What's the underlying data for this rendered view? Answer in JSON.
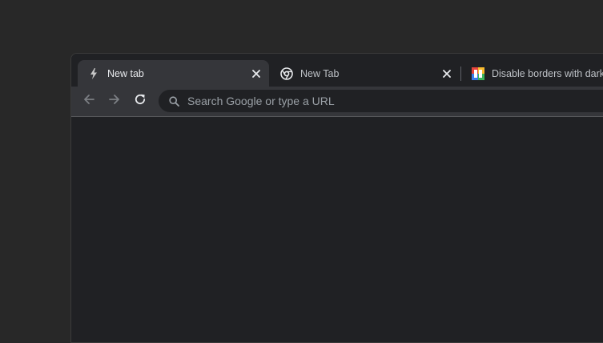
{
  "tabs": [
    {
      "title": "New tab",
      "favicon": "bolt-icon",
      "active": true
    },
    {
      "title": "New Tab",
      "favicon": "chrome-icon",
      "active": false
    },
    {
      "title": "Disable borders with dark a",
      "favicon": "colorful-app-icon",
      "active": false
    }
  ],
  "toolbar": {
    "back": "arrow-left-icon",
    "forward": "arrow-right-icon",
    "reload": "reload-icon"
  },
  "omnibox": {
    "placeholder": "Search Google or type a URL",
    "value": "",
    "icon": "search-icon"
  },
  "colors": {
    "desktop": "#282828",
    "frame": "#202124",
    "active_tab": "#35363a",
    "text": "#e8eaed",
    "placeholder": "#9aa0a6"
  }
}
